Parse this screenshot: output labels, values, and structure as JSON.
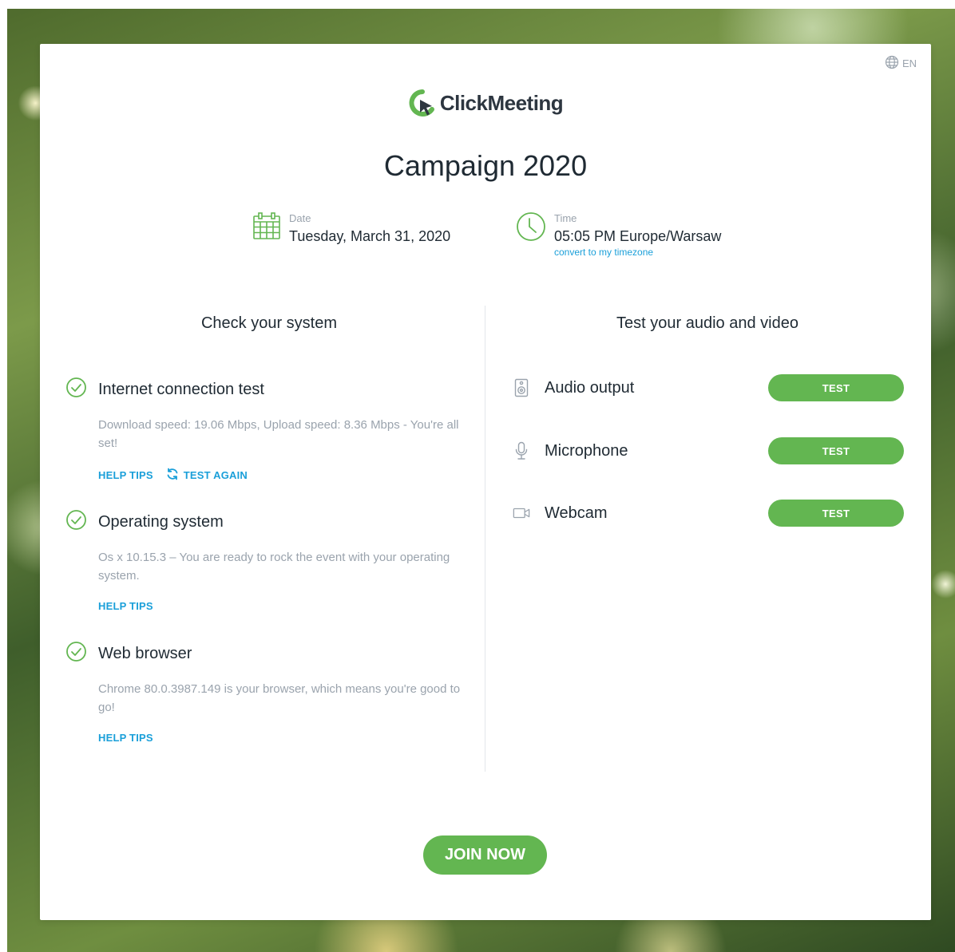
{
  "language": "EN",
  "brand": {
    "name": "ClickMeeting"
  },
  "event": {
    "title": "Campaign 2020",
    "date_label": "Date",
    "date_value": "Tuesday, March 31, 2020",
    "time_label": "Time",
    "time_value": "05:05 PM Europe/Warsaw",
    "convert_link": "convert to my timezone"
  },
  "system_check": {
    "heading": "Check your system",
    "items": [
      {
        "name": "Internet connection test",
        "description": "Download speed: 19.06 Mbps, Upload speed: 8.36 Mbps - You're all set!",
        "help": "HELP TIPS",
        "retest": "TEST AGAIN"
      },
      {
        "name": "Operating system",
        "description": "Os x 10.15.3 – You are ready to rock the event with your operating system.",
        "help": "HELP TIPS"
      },
      {
        "name": "Web browser",
        "description": "Chrome 80.0.3987.149 is your browser, which means you're good to go!",
        "help": "HELP TIPS"
      }
    ]
  },
  "av_test": {
    "heading": "Test your audio and video",
    "items": [
      {
        "name": "Audio output",
        "button": "TEST",
        "icon": "speaker-icon"
      },
      {
        "name": "Microphone",
        "button": "TEST",
        "icon": "microphone-icon"
      },
      {
        "name": "Webcam",
        "button": "TEST",
        "icon": "webcam-icon"
      }
    ]
  },
  "join_button": "JOIN NOW",
  "colors": {
    "accent_green": "#63b651",
    "link_blue": "#1a9fd9",
    "text_dark": "#1f2a33",
    "text_muted": "#9aa3ad"
  }
}
